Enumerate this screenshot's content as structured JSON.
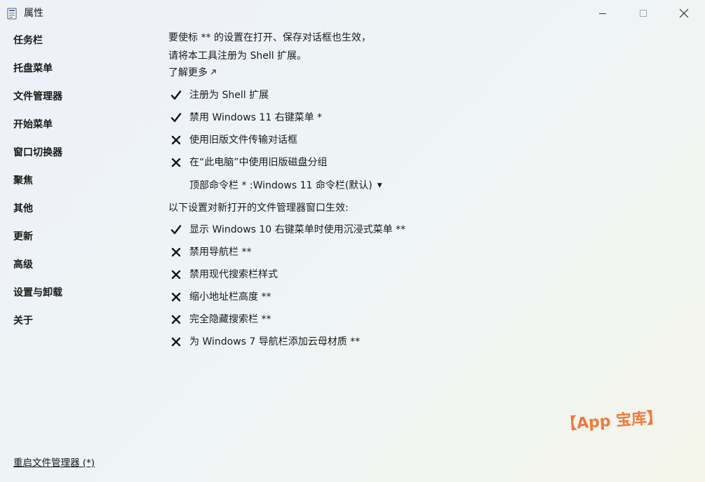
{
  "window": {
    "title": "属性",
    "icon": "settings-app-icon",
    "controls": {
      "minimize": "minimize-icon",
      "maximize": "maximize-icon",
      "close": "close-icon"
    }
  },
  "sidebar": {
    "items": [
      {
        "label": "任务栏"
      },
      {
        "label": "托盘菜单"
      },
      {
        "label": "文件管理器"
      },
      {
        "label": "开始菜单"
      },
      {
        "label": "窗口切换器"
      },
      {
        "label": "聚焦"
      },
      {
        "label": "其他"
      },
      {
        "label": "更新"
      },
      {
        "label": "高级"
      },
      {
        "label": "设置与卸载"
      },
      {
        "label": "关于"
      }
    ],
    "restart_link": "重启文件管理器 (*)"
  },
  "content": {
    "intro_line1": "要使标 ** 的设置在打开、保存对话框也生效，",
    "intro_line2": "请将本工具注册为 Shell 扩展。",
    "learn_more": "了解更多",
    "options_a": [
      {
        "label": "注册为 Shell 扩展",
        "checked": true
      },
      {
        "label": "禁用 Windows 11 右键菜单 *",
        "checked": true
      },
      {
        "label": "使用旧版文件传输对话框",
        "checked": false
      },
      {
        "label": "在“此电脑”中使用旧版磁盘分组",
        "checked": false
      }
    ],
    "dropdown": {
      "label": "顶部命令栏 * : ",
      "selected": "Windows 11 命令栏(默认)"
    },
    "section_note": "以下设置对新打开的文件管理器窗口生效:",
    "options_b": [
      {
        "label": "显示 Windows 10 右键菜单时使用沉浸式菜单 **",
        "checked": true
      },
      {
        "label": "禁用导航栏 **",
        "checked": false
      },
      {
        "label": "禁用现代搜索栏样式",
        "checked": false
      },
      {
        "label": "缩小地址栏高度 **",
        "checked": false
      },
      {
        "label": "完全隐藏搜索栏 **",
        "checked": false
      },
      {
        "label": "为 Windows 7 导航栏添加云母材质 **",
        "checked": false
      }
    ]
  },
  "watermark": "【App 宝库】",
  "colors": {
    "accent": "#1a1a1a",
    "watermark": "#f07a3c"
  }
}
